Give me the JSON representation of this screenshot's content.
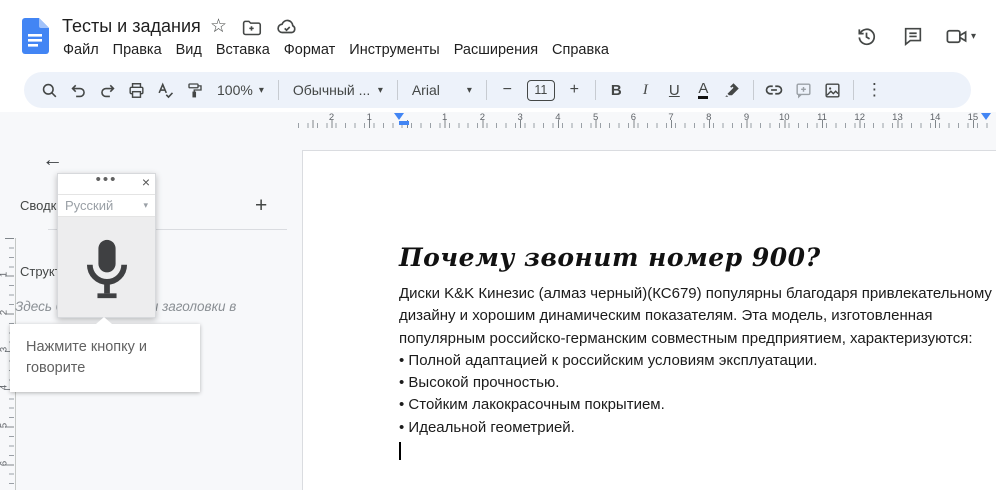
{
  "header": {
    "title": "Тесты и задания",
    "menus": [
      "Файл",
      "Правка",
      "Вид",
      "Вставка",
      "Формат",
      "Инструменты",
      "Расширения",
      "Справка"
    ]
  },
  "toolbar": {
    "zoom_value": "100%",
    "style_value": "Обычный ...",
    "font_value": "Arial",
    "font_size": "11",
    "bold_label": "B",
    "italic_label": "I",
    "underline_label": "U",
    "text_color_label": "A",
    "minus_label": "−",
    "plus_label": "+"
  },
  "icons": {
    "star": "☆",
    "dropdown": "▾",
    "overflow": "⋮",
    "back": "←",
    "close": "×",
    "drag": "•••",
    "add": "+"
  },
  "ruler": {
    "h_left_labels": [
      "2",
      "1"
    ],
    "h_right_labels": [
      "1",
      "2",
      "3",
      "4",
      "5",
      "6",
      "7",
      "8",
      "9",
      "10",
      "11",
      "12",
      "13",
      "14",
      "15"
    ],
    "v_labels": [
      "1",
      "2",
      "3",
      "4",
      "5",
      "6"
    ]
  },
  "panel": {
    "summary_label": "Сводка",
    "outline_label": "Структура",
    "outline_hint": "Здесь будут показаны заголовки в"
  },
  "voice": {
    "language": "Русский",
    "tooltip": "Нажмите кнопку и говорите"
  },
  "doc": {
    "heading": "Почему звонит номер 900?",
    "lines": [
      "Диски K&K Кинезис (алмаз черный)(КС679) популярны благодаря привлекательному",
      "дизайну и хорошим динамическим показателям. Эта модель, изготовленная",
      "популярным российско-германским совместным предприятием, характеризуются:",
      "• Полной адаптацией к российским условиям эксплуатации.",
      "• Высокой прочностью.",
      "• Стойким лакокрасочным покрытием.",
      "• Идеальной геометрией."
    ]
  },
  "colors": {
    "accent": "#4285f4",
    "toolbar_bg": "#edf2fa"
  }
}
